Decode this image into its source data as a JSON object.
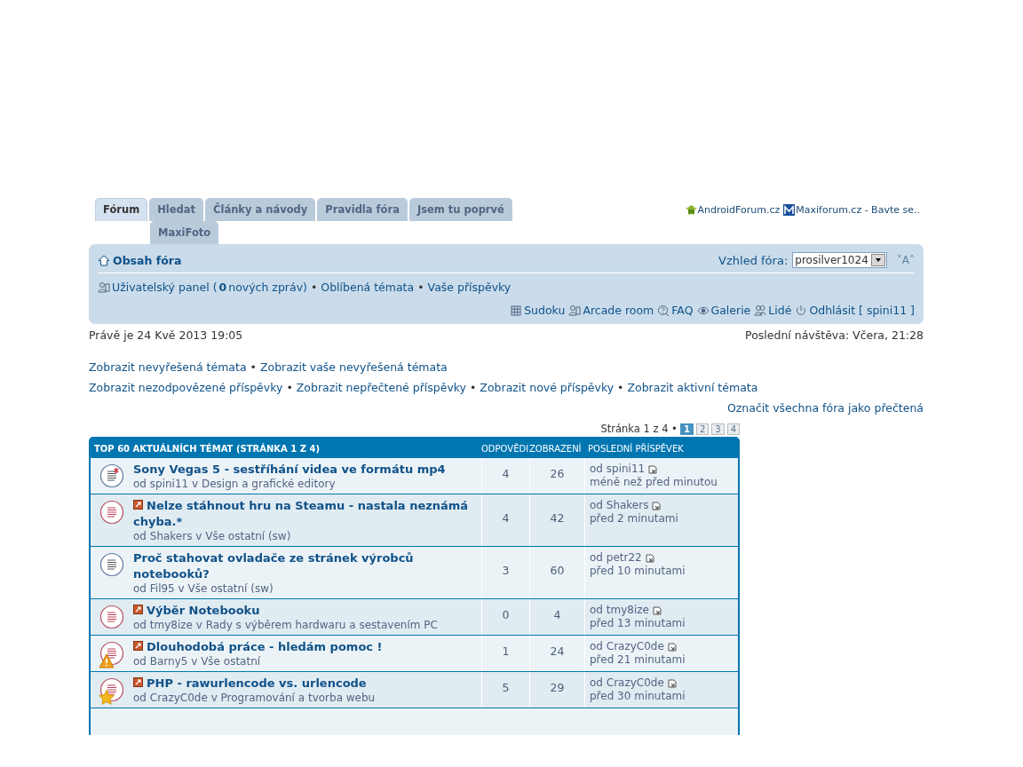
{
  "tabs": [
    {
      "label": "Fórum",
      "selected": true
    },
    {
      "label": "Hledat",
      "selected": false
    },
    {
      "label": "Články a návody",
      "selected": false
    },
    {
      "label": "Pravidla fóra",
      "selected": false
    },
    {
      "label": "Jsem tu poprvé",
      "selected": false
    },
    {
      "label": "MaxiFoto",
      "selected": false
    }
  ],
  "partner_links": [
    {
      "kind": "android",
      "label": "AndroidForum.cz"
    },
    {
      "kind": "maxi",
      "label": "Maxiforum.cz - Bavte se.."
    }
  ],
  "navbar": {
    "home": "Obsah fóra",
    "style_label": "Vzhled fóra:",
    "style_value": "prosilver1024",
    "font_size": "˅A˄",
    "user_panel": {
      "before": "Uživatelský panel (",
      "count": "0",
      "after": " nových zpráv)"
    },
    "separator": "•",
    "user_links": [
      "Oblíbená témata",
      "Vaše příspěvky"
    ],
    "tools": [
      {
        "kind": "grid",
        "label": "Sudoku"
      },
      {
        "kind": "user",
        "label": "Arcade room"
      },
      {
        "kind": "faq",
        "label": "FAQ"
      },
      {
        "kind": "eye",
        "label": "Galerie"
      },
      {
        "kind": "people",
        "label": "Lidé"
      },
      {
        "kind": "power",
        "label": "Odhlásit [ spini11 ]"
      }
    ]
  },
  "now": "Právě je 24 Kvě 2013 19:05",
  "last_visit": "Poslední návštěva: Včera, 21:28",
  "link_lines": [
    [
      "Zobrazit nevyřešená témata",
      "Zobrazit vaše nevyřešená témata"
    ],
    [
      "Zobrazit nezodpovězené příspěvky",
      "Zobrazit nepřečtené příspěvky",
      "Zobrazit nové příspěvky",
      "Zobrazit aktivní témata"
    ]
  ],
  "mark_read": "Označit všechna fóra jako přečtená",
  "pagination": {
    "label": "Stránka 1 z 4 •",
    "pages": [
      {
        "label": "1",
        "selected": true
      },
      {
        "label": "2",
        "selected": false
      },
      {
        "label": "3",
        "selected": false
      },
      {
        "label": "4",
        "selected": false
      }
    ]
  },
  "table": {
    "columns": [
      "TOP 60 AKTUÁLNÍCH TÉMAT  (STRÁNKA 1 Z 4)",
      "ODPOVĚDI",
      "ZOBRAZENÍ",
      "POSLEDNÍ PŘÍSPĚVEK"
    ],
    "rows": [
      {
        "kind": "read-mine",
        "new_post": false,
        "title": "Sony Vegas 5 - sestříhání videa ve formátu mp4",
        "meta": "od spini11 v Design a grafické editory",
        "replies": "4",
        "views": "26",
        "last_by": "od spini11",
        "last_time": "méně než před minutou"
      },
      {
        "kind": "unread",
        "new_post": true,
        "title": "Nelze stáhnout hru na Steamu - nastala neznámá chyba.*",
        "meta": "od Shakers v Vše ostatní (sw)",
        "replies": "4",
        "views": "42",
        "last_by": "od Shakers",
        "last_time": "před 2 minutami"
      },
      {
        "kind": "read",
        "new_post": false,
        "title": "Proč stahovat ovladače ze stránek výrobců notebooků?",
        "meta": "od Fil95 v Vše ostatní (sw)",
        "replies": "3",
        "views": "60",
        "last_by": "od petr22",
        "last_time": "před 10 minutami"
      },
      {
        "kind": "unread",
        "new_post": true,
        "title": "Výběr Notebooku",
        "meta": "od tmy8ize v Rady s výběrem hardwaru a sestavením PC",
        "replies": "0",
        "views": "4",
        "last_by": "od tmy8ize",
        "last_time": "před 13 minutami"
      },
      {
        "kind": "unread-warning",
        "new_post": true,
        "title": "Dlouhodobá práce - hledám pomoc !",
        "meta": "od Barny5 v Vše ostatní",
        "replies": "1",
        "views": "24",
        "last_by": "od CrazyC0de",
        "last_time": "před 21 minutami"
      },
      {
        "kind": "unread-star",
        "new_post": true,
        "title": "PHP - rawurlencode vs. urlencode",
        "meta": "od CrazyC0de v Programování a tvorba webu",
        "replies": "5",
        "views": "29",
        "last_by": "od CrazyC0de",
        "last_time": "před 30 minutami"
      }
    ]
  }
}
